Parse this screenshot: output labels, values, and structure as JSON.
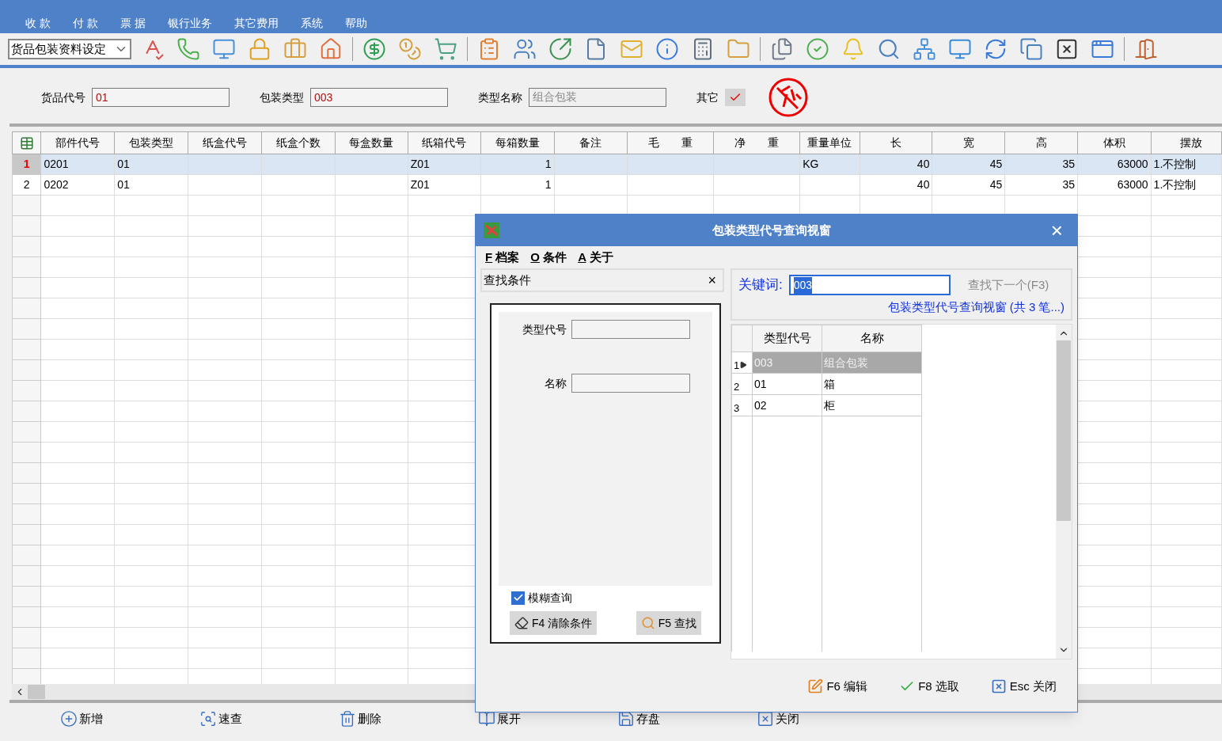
{
  "menu": [
    "收 款",
    "付 款",
    "票 据",
    "银行业务",
    "其它费用",
    "系统",
    "帮助"
  ],
  "toolbar": {
    "module_select": "货品包装资料设定"
  },
  "form": {
    "fields": [
      {
        "label": "货品代号",
        "value": "01",
        "disabled": false
      },
      {
        "label": "包装类型",
        "value": "003",
        "disabled": false
      },
      {
        "label": "类型名称",
        "value": "组合包装",
        "disabled": true
      }
    ],
    "other": {
      "label": "其它",
      "checked": true
    }
  },
  "grid": {
    "columns": [
      "部件代号",
      "包装类型",
      "纸盒代号",
      "纸盒个数",
      "每盒数量",
      "纸箱代号",
      "每箱数量",
      "备注",
      "毛　　重",
      "净　　重",
      "重量单位",
      "长",
      "宽",
      "高",
      "体积",
      "摆放"
    ],
    "rows": [
      {
        "num": "1",
        "selected": true,
        "cells": [
          "0201",
          "01",
          "",
          "",
          "",
          "Z01",
          "1",
          "",
          "",
          "",
          "KG",
          "40",
          "45",
          "35",
          "63000",
          "1.不控制"
        ]
      },
      {
        "num": "2",
        "selected": false,
        "cells": [
          "0202",
          "01",
          "",
          "",
          "",
          "Z01",
          "1",
          "",
          "",
          "",
          "",
          "40",
          "45",
          "35",
          "63000",
          "1.不控制"
        ]
      }
    ]
  },
  "dialog": {
    "title": "包装类型代号查询视窗",
    "close": "×",
    "menu": [
      {
        "key": "F",
        "label": "档案"
      },
      {
        "key": "O",
        "label": "条件"
      },
      {
        "key": "A",
        "label": "关于"
      }
    ],
    "find_panel": {
      "title": "查找条件",
      "close": "×",
      "fields": [
        "类型代号",
        "名称"
      ],
      "fuzzy": {
        "label": "模糊查询",
        "checked": true
      },
      "buttons": [
        "F4 清除条件",
        "F5 查找"
      ]
    },
    "keyword": {
      "label": "关键词:",
      "value": "003",
      "find_next": "查找下一个(F3)",
      "summary": "包装类型代号查询视窗 (共 3 笔...)"
    },
    "results": {
      "columns": [
        "类型代号",
        "名称"
      ],
      "rows": [
        {
          "num": "1",
          "selected": true,
          "cells": [
            "003",
            "组合包装"
          ]
        },
        {
          "num": "2",
          "selected": false,
          "cells": [
            "01",
            "箱"
          ]
        },
        {
          "num": "3",
          "selected": false,
          "cells": [
            "02",
            "柜"
          ]
        }
      ]
    },
    "buttons": [
      "F6 编辑",
      "F8 选取",
      "Esc 关闭"
    ]
  },
  "bottom_bar": [
    "新增",
    "速查",
    "删除",
    "展开",
    "存盘",
    "关闭"
  ]
}
